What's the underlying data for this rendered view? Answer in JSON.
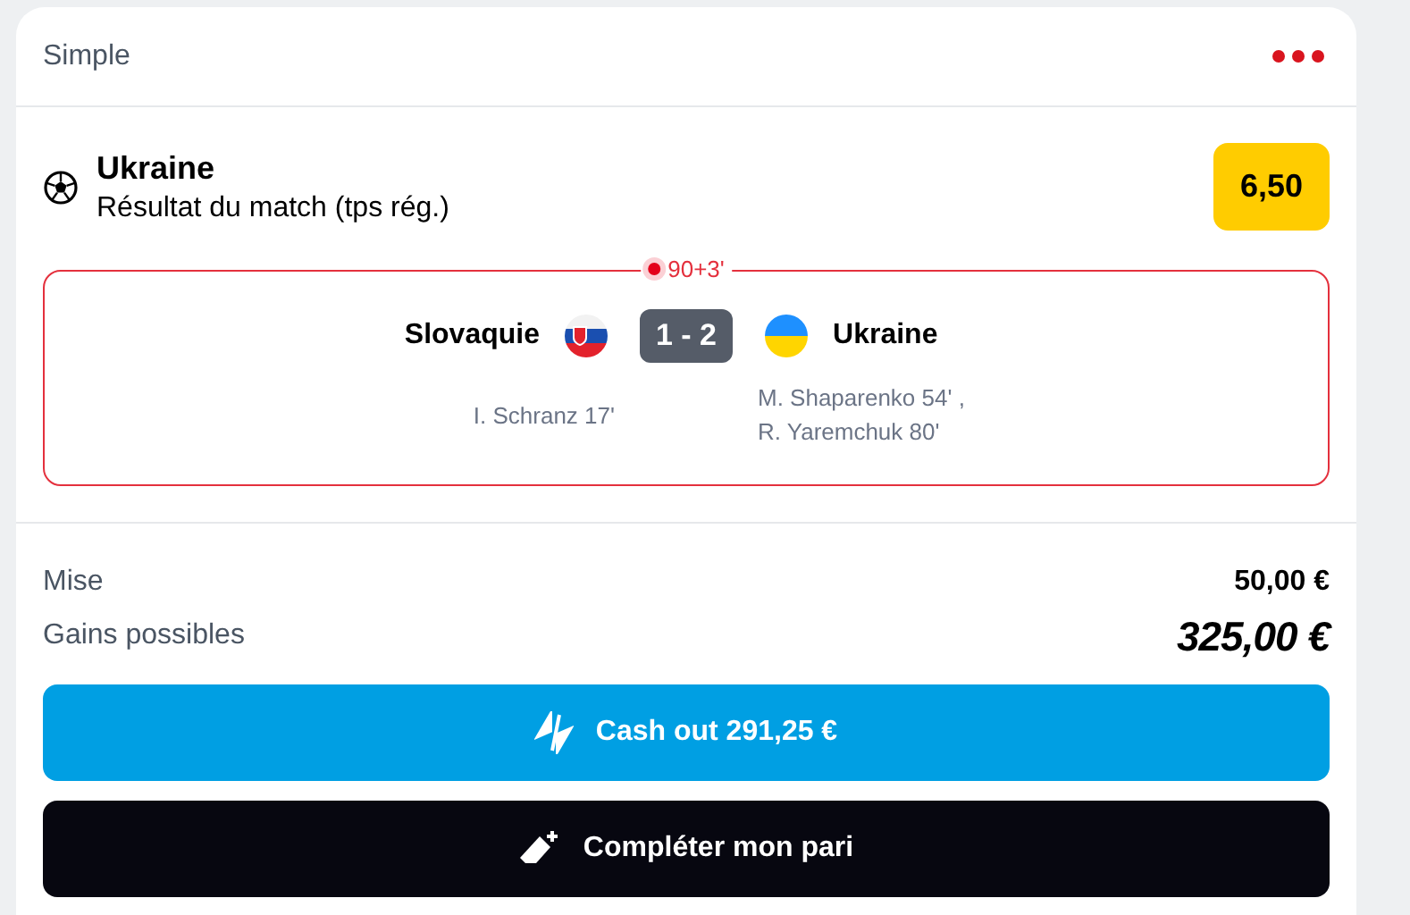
{
  "header": {
    "title": "Simple"
  },
  "selection": {
    "name": "Ukraine",
    "market": "Résultat du match (tps rég.)",
    "odds": "6,50"
  },
  "match": {
    "live": true,
    "minute": "90+3'",
    "score": "1 - 2",
    "home": {
      "name": "Slovaquie",
      "kind": "slovakia",
      "scorers": [
        "I. Schranz 17'"
      ]
    },
    "away": {
      "name": "Ukraine",
      "kind": "ukraine",
      "scorers": [
        "M. Shaparenko 54' ,",
        "R. Yaremchuk 80'"
      ]
    }
  },
  "summary": [
    {
      "label": "Mise",
      "value": "50,00 €",
      "kind": "plain"
    },
    {
      "label": "Gains possibles",
      "value": "325,00 €",
      "kind": "highlight"
    }
  ],
  "buttons": [
    {
      "label": "Cash out 291,25 €",
      "kind": "cashout"
    },
    {
      "label": "Compléter mon pari",
      "kind": "complete"
    }
  ]
}
